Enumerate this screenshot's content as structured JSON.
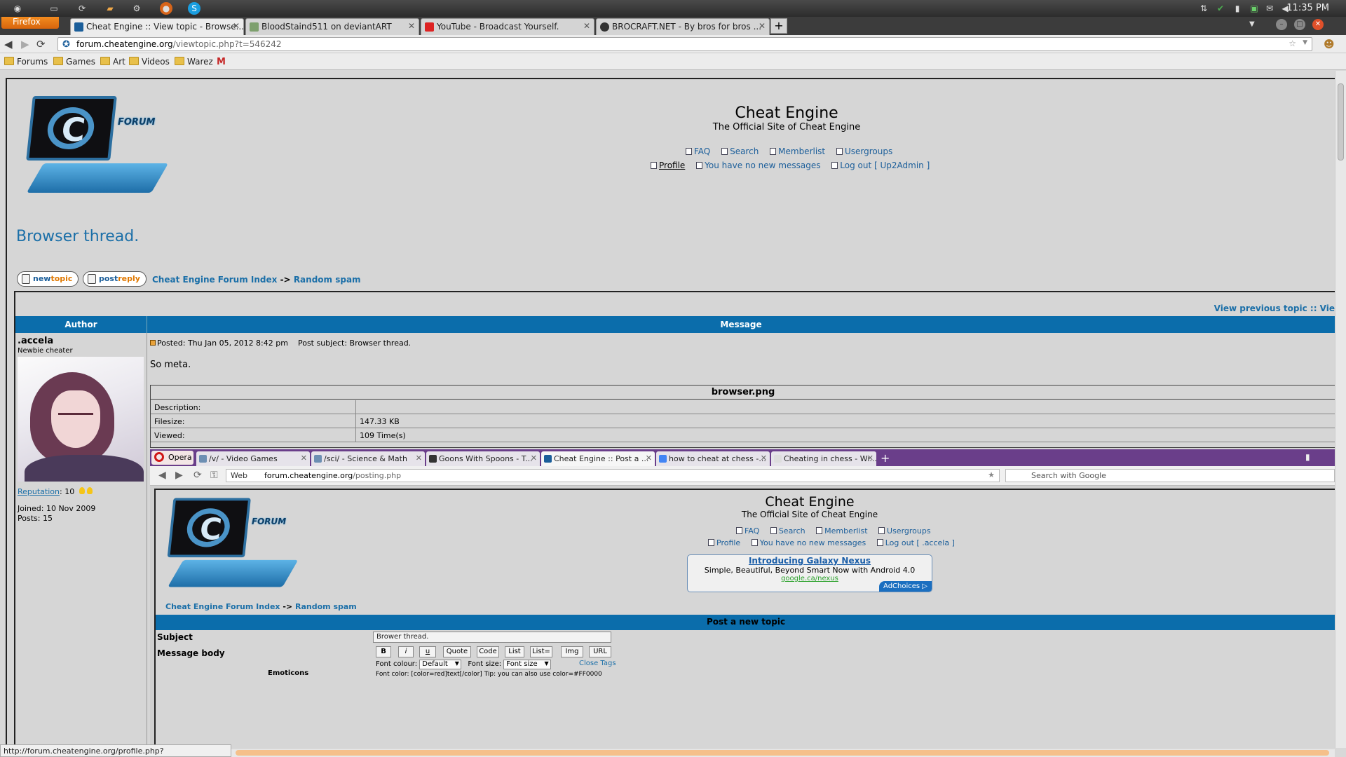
{
  "os": {
    "clock": "11:35 PM"
  },
  "firefox": {
    "menu_label": "Firefox",
    "tabs": [
      {
        "title": "Cheat Engine :: View topic - Browse...",
        "active": true
      },
      {
        "title": "BloodStaind511 on deviantART",
        "active": false
      },
      {
        "title": "YouTube - Broadcast Yourself.",
        "active": false
      },
      {
        "title": "BROCRAFT.NET - By bros for bros ...",
        "active": false
      }
    ],
    "url_host": "forum.cheatengine.org",
    "url_path": "/viewtopic.php?t=546242",
    "bookmarks": [
      "Forums",
      "Games",
      "Art",
      "Videos",
      "Warez"
    ],
    "status_url": "http://forum.cheatengine.org/profile.php?mode=editprofile"
  },
  "site": {
    "logo_tag": "FORUM",
    "title": "Cheat Engine",
    "subtitle": "The Official Site of Cheat Engine",
    "links_row1": [
      "FAQ",
      "Search",
      "Memberlist",
      "Usergroups"
    ],
    "link_profile": "Profile",
    "link_messages": "You have no new messages",
    "link_logout": "Log out [ Up2Admin ]"
  },
  "topic": {
    "title": "Browser thread.",
    "newtopic_a": "new",
    "newtopic_b": "topic",
    "postreply_a": "post",
    "postreply_b": "reply",
    "crumb_index": "Cheat Engine Forum Index",
    "crumb_sep": "->",
    "crumb_forum": "Random spam",
    "prev_next": "View previous topic :: Vie",
    "col_author": "Author",
    "col_message": "Message"
  },
  "post": {
    "author": ".accela",
    "rank": "Newbie cheater",
    "reputation_label": "Reputation",
    "reputation_value": ": 10",
    "joined": "Joined: 10 Nov 2009",
    "posts": "Posts: 15",
    "posted": "Posted: Thu Jan 05, 2012 8:42 pm",
    "subject": "Post subject: Browser thread.",
    "body": "So meta.",
    "attachment": {
      "filename": "browser.png",
      "rows": [
        {
          "k": "Description:",
          "v": ""
        },
        {
          "k": "Filesize:",
          "v": "147.33 KB"
        },
        {
          "k": "Viewed:",
          "v": "109 Time(s)"
        }
      ]
    }
  },
  "screenshot": {
    "opera_label": "Opera",
    "tabs": [
      {
        "title": "/v/ - Video Games",
        "active": false
      },
      {
        "title": "/sci/ - Science & Math",
        "active": false
      },
      {
        "title": "Goons With Spoons - T...",
        "active": false
      },
      {
        "title": "Cheat Engine :: Post a ...",
        "active": true
      },
      {
        "title": "how to cheat at chess -...",
        "active": false
      },
      {
        "title": "Cheating in chess - Wi...",
        "active": false
      }
    ],
    "url_prefix": "Web",
    "url_host": "forum.cheatengine.org",
    "url_path": "/posting.php",
    "search_placeholder": "Search with Google",
    "site_title": "Cheat Engine",
    "site_subtitle": "The Official Site of Cheat Engine",
    "links_row1": [
      "FAQ",
      "Search",
      "Memberlist",
      "Usergroups"
    ],
    "link_profile": "Profile",
    "link_messages": "You have no new messages",
    "link_logout": "Log out [ .accela ]",
    "ad_title": "Introducing Galaxy Nexus",
    "ad_text": "Simple, Beautiful, Beyond Smart Now with Android 4.0",
    "ad_url": "google.ca/nexus",
    "ad_choices": "AdChoices ▷",
    "crumb_index": "Cheat Engine Forum Index",
    "crumb_forum": "Random spam",
    "post_header": "Post a new topic",
    "label_subject": "Subject",
    "label_body": "Message body",
    "label_emoticons": "Emoticons",
    "subject_value": "Brower thread.",
    "format_buttons": [
      "B",
      "i",
      "u",
      "Quote",
      "Code",
      "List",
      "List=",
      "Img",
      "URL"
    ],
    "font_colour_label": "Font colour:",
    "font_colour_value": "Default",
    "font_size_label": "Font size:",
    "font_size_value": "Font size",
    "close_tags": "Close Tags",
    "tip": "Font color: [color=red]text[/color]  Tip: you can also use color=#FF0000"
  }
}
